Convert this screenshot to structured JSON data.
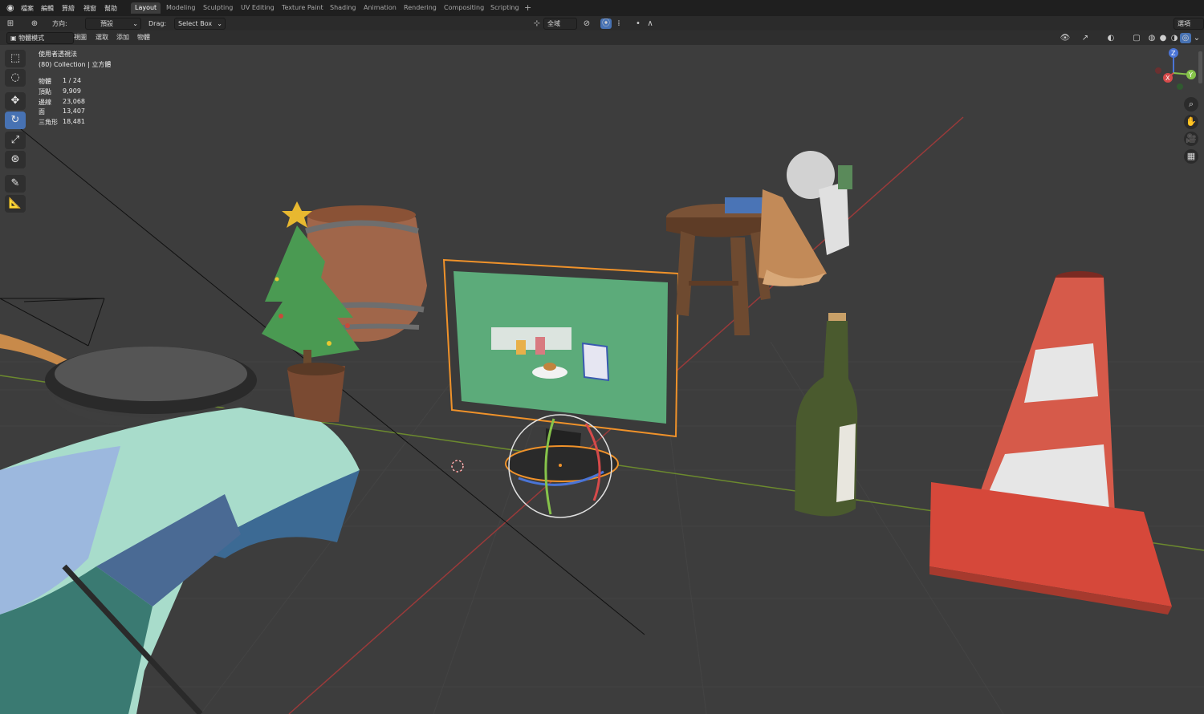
{
  "menu": [
    "檔案",
    "編輯",
    "算繪",
    "視窗",
    "幫助"
  ],
  "workspace_tabs": [
    "Layout",
    "Modeling",
    "Sculpting",
    "UV Editing",
    "Texture Paint",
    "Shading",
    "Animation",
    "Rendering",
    "Compositing",
    "Scripting"
  ],
  "active_tab": "Layout",
  "header": {
    "orientation_label": "方向:",
    "orientation_value": "預設",
    "drag_label": "Drag:",
    "drag_value": "Select Box",
    "pivot_value": "全域",
    "options_label": "選項"
  },
  "header2": {
    "mode_value": "物體模式",
    "menus": [
      "視圖",
      "選取",
      "添加",
      "物體"
    ]
  },
  "viewport_overlay": {
    "view_name": "使用者透視法",
    "collection": "(80) Collection | 立方體",
    "stats": [
      {
        "label": "物體",
        "value": "1 / 24"
      },
      {
        "label": "頂點",
        "value": "9,909"
      },
      {
        "label": "邊線",
        "value": "23,068"
      },
      {
        "label": "面",
        "value": "13,407"
      },
      {
        "label": "三角形",
        "value": "18,481"
      }
    ]
  },
  "gizmo_axes": {
    "x": "X",
    "y": "Y",
    "z": "Z"
  },
  "tools": [
    "select-box-icon",
    "cursor-icon",
    "move-icon",
    "rotate-icon",
    "scale-icon",
    "transform-icon",
    "annotate-icon",
    "measure-icon"
  ],
  "active_tool": "rotate-icon",
  "nav_buttons": [
    "zoom-icon",
    "pan-icon",
    "camera-icon",
    "ortho-grid-icon"
  ],
  "colors": {
    "grid_bg": "#3d3d3d",
    "x_axis": "#9a3a3a",
    "y_axis": "#6c8a2e",
    "selection": "#f0922a",
    "active_blue": "#4772b3"
  }
}
